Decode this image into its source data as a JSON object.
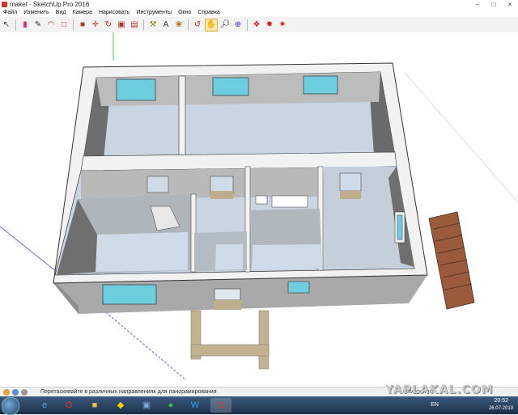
{
  "window": {
    "title": "maket - SketchUp Pro 2016",
    "minimize": "–",
    "maximize": "□",
    "close": "×"
  },
  "menu": [
    "Файл",
    "Изменить",
    "Вид",
    "Камера",
    "Нарисовать",
    "Инструменты",
    "Окно",
    "Справка"
  ],
  "toolbar": {
    "icons": [
      "select-icon",
      "eraser-icon",
      "pencil-icon",
      "arc-icon",
      "shape-icon",
      "push-pull-icon",
      "move-icon",
      "rotate-icon",
      "scale-icon",
      "offset-icon",
      "tape-icon",
      "text-icon",
      "paint-icon",
      "orbit-icon",
      "pan-icon",
      "zoom-icon",
      "zoom-extents-icon",
      "warehouse-icon",
      "extension-icon",
      "layout-icon"
    ]
  },
  "status": {
    "text": "Перетаскивайте в различных направлениях для панорамирования",
    "measure_label": "Измерения"
  },
  "taskbar": {
    "apps": [
      "explorer",
      "opera",
      "files",
      "batman",
      "save",
      "chrome",
      "word",
      "sketchup"
    ],
    "lang": "EN",
    "time": "20:52",
    "date": "26.07.2019"
  },
  "watermark": "YAPLAKAL.COM"
}
